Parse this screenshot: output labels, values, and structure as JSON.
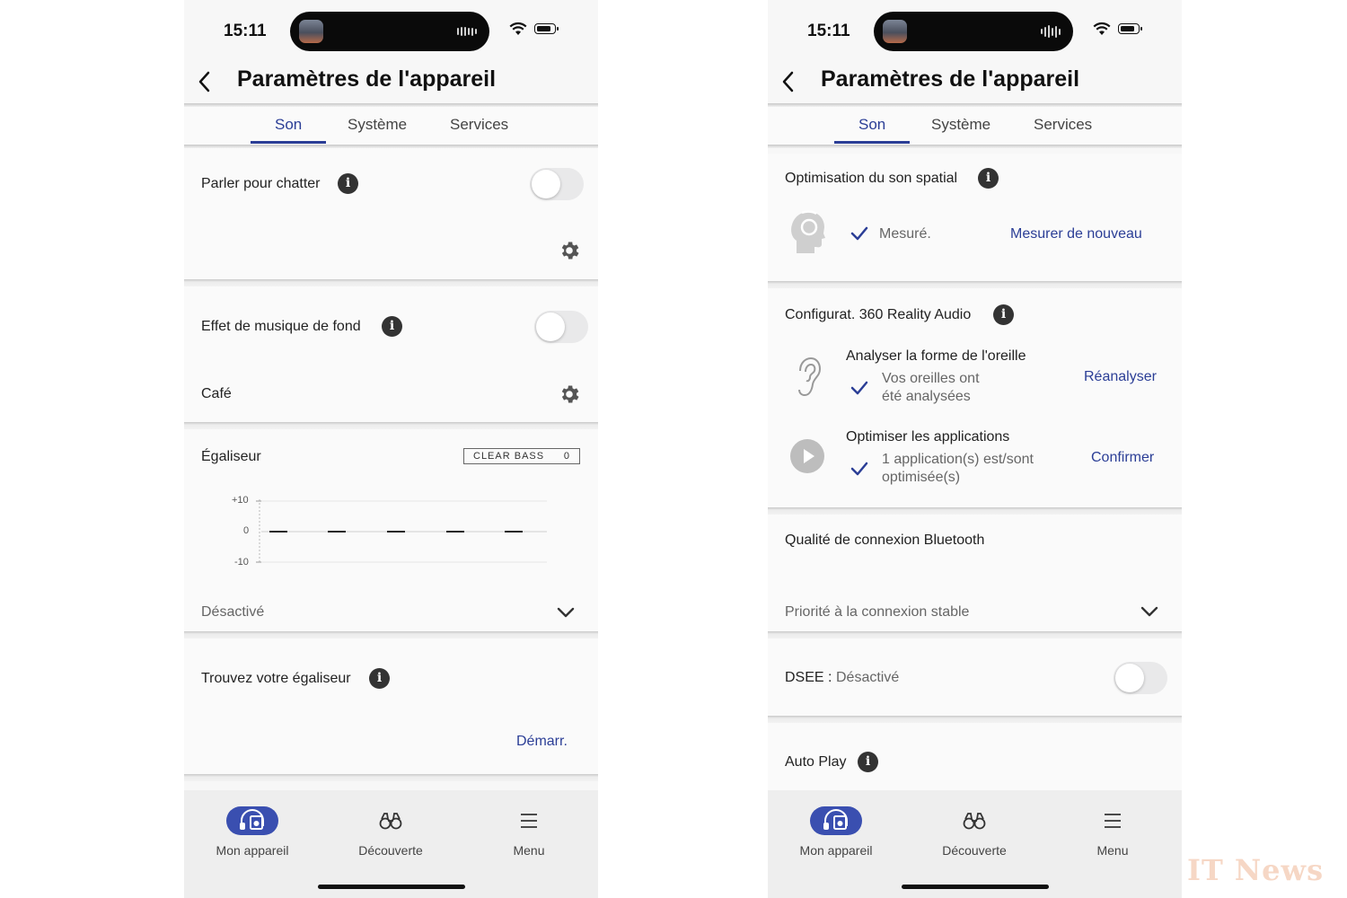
{
  "status": {
    "time": "15:11"
  },
  "header": {
    "title": "Paramètres de l'appareil"
  },
  "tabs": [
    "Son",
    "Système",
    "Services"
  ],
  "left": {
    "speak_to_chat": {
      "label": "Parler pour chatter",
      "enabled": false
    },
    "background_music": {
      "label": "Effet de musique de fond",
      "enabled": false,
      "preset": "Café"
    },
    "equalizer": {
      "label": "Égaliseur",
      "clear_bass_label": "CLEAR BASS",
      "clear_bass_value": "0",
      "y_ticks": [
        "+10",
        "0",
        "-10"
      ],
      "preset": "Désactivé"
    },
    "find_eq": {
      "label": "Trouvez votre égaliseur",
      "action": "Démarr."
    }
  },
  "right": {
    "spatial": {
      "label": "Optimisation du son spatial",
      "status": "Mesuré.",
      "action": "Mesurer de nouveau"
    },
    "reality_audio": {
      "label": "Configurat. 360 Reality Audio",
      "ear_title": "Analyser la forme de l'oreille",
      "ear_status_1": "Vos oreilles ont",
      "ear_status_2": "été analysées",
      "ear_action": "Réanalyser",
      "apps_title": "Optimiser les applications",
      "apps_status_1": "1 application(s) est/sont",
      "apps_status_2": "optimisée(s)",
      "apps_action": "Confirmer"
    },
    "bluetooth": {
      "label": "Qualité de connexion Bluetooth",
      "value": "Priorité à la connexion stable"
    },
    "dsee": {
      "label": "DSEE :",
      "value": "Désactivé",
      "enabled": false
    },
    "auto_play": {
      "label": "Auto Play"
    }
  },
  "bottom_nav": [
    "Mon appareil",
    "Découverte",
    "Menu"
  ],
  "watermark": "IT News",
  "colors": {
    "accent": "#2b3e96",
    "nav_active": "#3a4fb0",
    "info_icon": "#333333",
    "background": "#fafafa"
  }
}
